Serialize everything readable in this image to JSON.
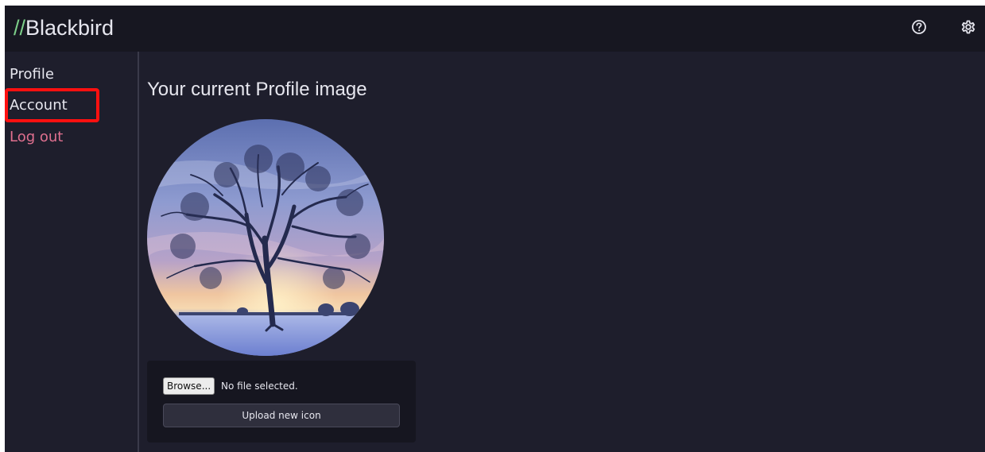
{
  "header": {
    "brand_prefix": "//",
    "brand_name": "Blackbird",
    "icons": [
      "help-icon",
      "settings-icon"
    ]
  },
  "sidebar": {
    "items": [
      {
        "label": "Profile"
      },
      {
        "label": "Account"
      },
      {
        "label": "Log out"
      }
    ],
    "highlighted_item": "Account"
  },
  "main": {
    "title": "Your current Profile image",
    "upload": {
      "browse_label": "Browse...",
      "file_status": "No file selected.",
      "upload_label": "Upload new icon"
    }
  },
  "colors": {
    "background": "#1e1e2c",
    "topbar": "#171721",
    "brand_accent": "#7dd08a",
    "logout": "#e0708f",
    "highlight": "#ff1010"
  }
}
